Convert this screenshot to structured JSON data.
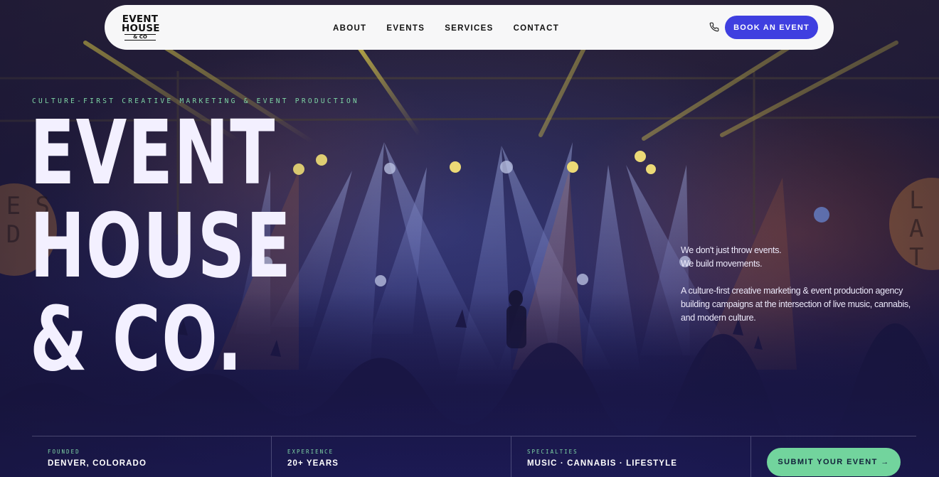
{
  "nav": {
    "logo": {
      "line1": "EVENT",
      "line2": "HOUSE",
      "line3": "& CO"
    },
    "links": [
      "ABOUT",
      "EVENTS",
      "SERVICES",
      "CONTACT"
    ],
    "cta": "BOOK AN EVENT",
    "phone_icon": "phone-icon"
  },
  "hero": {
    "tagline": "CULTURE-FIRST CREATIVE MARKETING & EVENT PRODUCTION",
    "title_lines": [
      "EVENT",
      "HOUSE",
      "& CO."
    ],
    "intro_lead_1": "We don't just throw events.",
    "intro_lead_2": "We build movements.",
    "intro_body": "A culture-first creative marketing & event production agency building campaigns at the intersection of live music, cannabis, and modern culture."
  },
  "background_banners": {
    "left": "E S\nR D E\nE",
    "right": "L\nA R\nT"
  },
  "stats": [
    {
      "label": "FOUNDED",
      "value": "DENVER, COLORADO"
    },
    {
      "label": "EXPERIENCE",
      "value": "20+ YEARS"
    },
    {
      "label": "SPECIALTIES",
      "value": "MUSIC · CANNABIS · LIFESTYLE"
    }
  ],
  "submit_cta": "SUBMIT YOUR EVENT →",
  "colors": {
    "accent_blue": "#3f3fe0",
    "accent_green": "#72d49d",
    "tagline_green": "#7fd6a6",
    "background": "#1c1a52"
  }
}
